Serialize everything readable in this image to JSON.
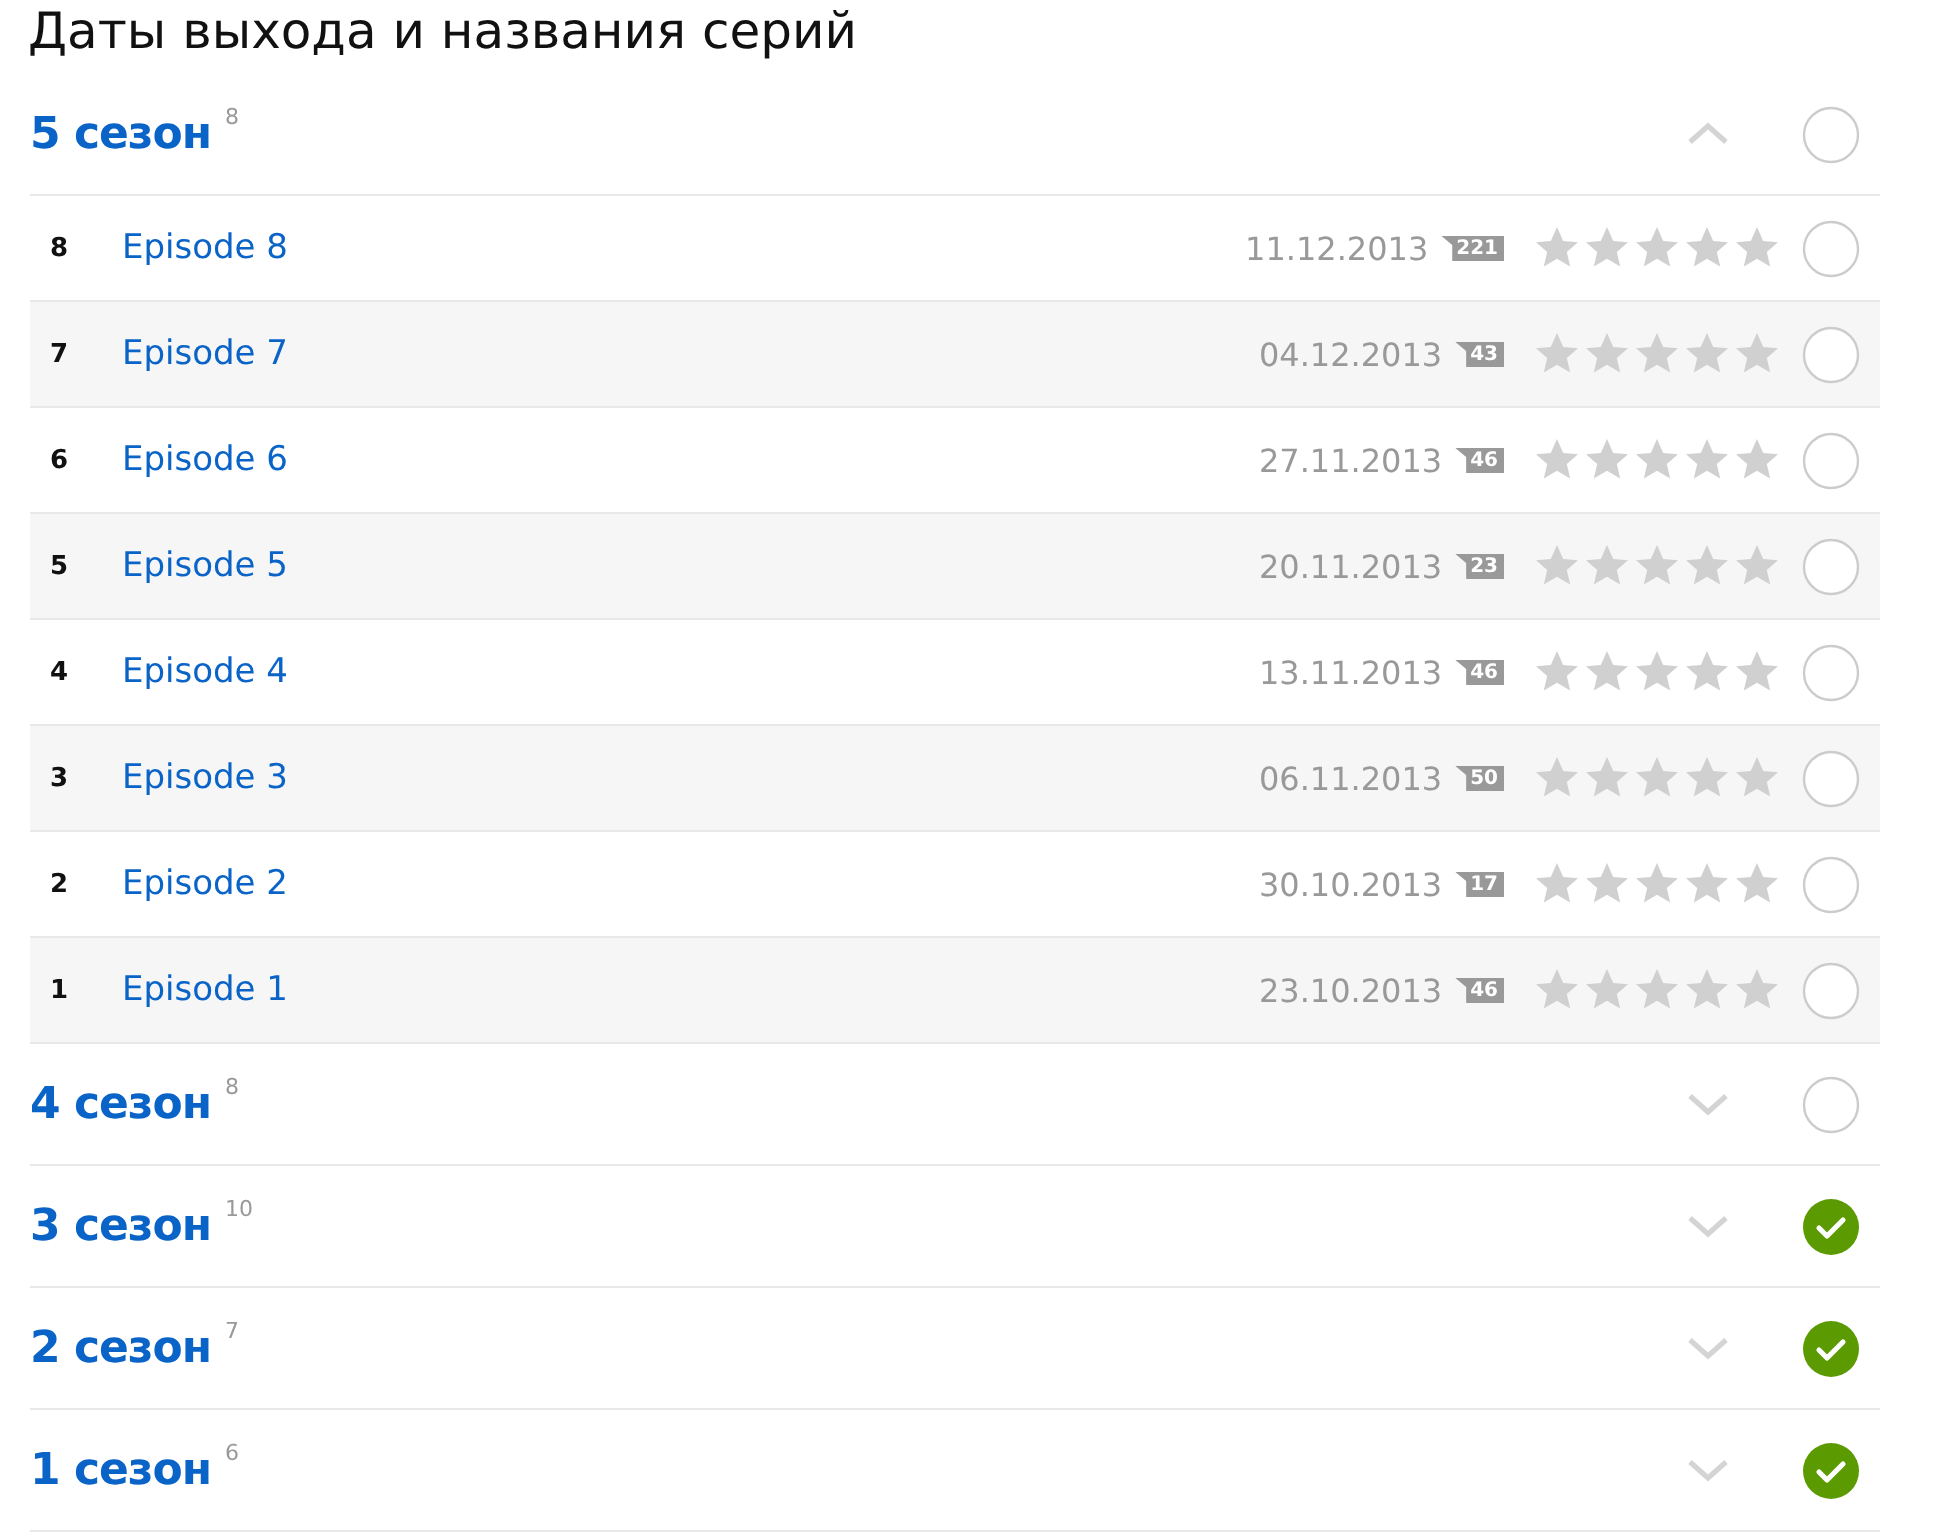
{
  "title": "Даты выхода и названия серий",
  "seasons": [
    {
      "name": "5 сезон",
      "count": "8",
      "expanded": true,
      "watched": false,
      "episodes": [
        {
          "number": "8",
          "title": "Episode 8",
          "date": "11.12.2013",
          "comments": "221",
          "stars": 0,
          "watched": false
        },
        {
          "number": "7",
          "title": "Episode 7",
          "date": "04.12.2013",
          "comments": "43",
          "stars": 0,
          "watched": false
        },
        {
          "number": "6",
          "title": "Episode 6",
          "date": "27.11.2013",
          "comments": "46",
          "stars": 0,
          "watched": false
        },
        {
          "number": "5",
          "title": "Episode 5",
          "date": "20.11.2013",
          "comments": "23",
          "stars": 0,
          "watched": false
        },
        {
          "number": "4",
          "title": "Episode 4",
          "date": "13.11.2013",
          "comments": "46",
          "stars": 0,
          "watched": false
        },
        {
          "number": "3",
          "title": "Episode 3",
          "date": "06.11.2013",
          "comments": "50",
          "stars": 0,
          "watched": false
        },
        {
          "number": "2",
          "title": "Episode 2",
          "date": "30.10.2013",
          "comments": "17",
          "stars": 0,
          "watched": false
        },
        {
          "number": "1",
          "title": "Episode 1",
          "date": "23.10.2013",
          "comments": "46",
          "stars": 0,
          "watched": false
        }
      ]
    },
    {
      "name": "4 сезон",
      "count": "8",
      "expanded": false,
      "watched": false
    },
    {
      "name": "3 сезон",
      "count": "10",
      "expanded": false,
      "watched": true
    },
    {
      "name": "2 сезон",
      "count": "7",
      "expanded": false,
      "watched": true
    },
    {
      "name": "1 сезон",
      "count": "6",
      "expanded": false,
      "watched": true
    }
  ]
}
